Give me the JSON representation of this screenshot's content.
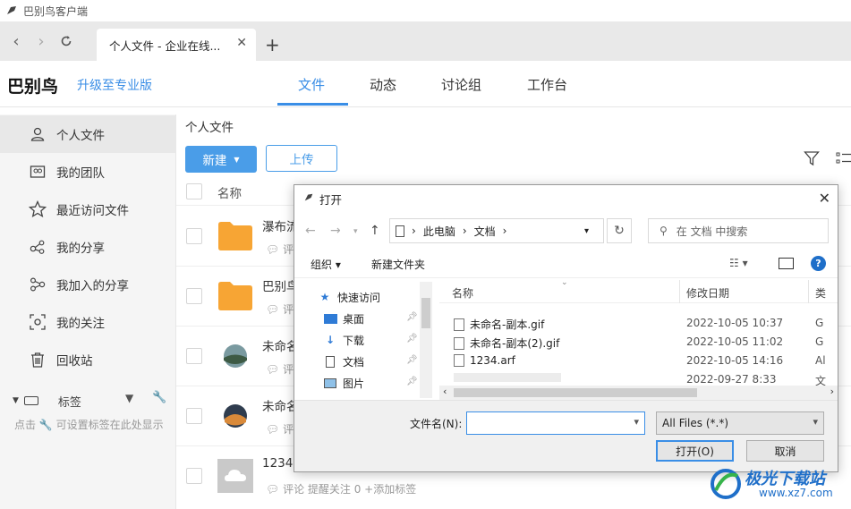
{
  "window": {
    "title": "巴别鸟客户端"
  },
  "browser": {
    "tab_title": "个人文件 - 企业在线...",
    "new_tab": "+"
  },
  "header": {
    "brand": "巴别鸟",
    "upgrade": "升级至专业版",
    "tabs": [
      "文件",
      "动态",
      "讨论组",
      "工作台"
    ],
    "active_tab": "文件"
  },
  "sidebar": {
    "items": [
      {
        "label": "个人文件",
        "icon": "user-icon"
      },
      {
        "label": "我的团队",
        "icon": "team-icon"
      },
      {
        "label": "最近访问文件",
        "icon": "star-icon"
      },
      {
        "label": "我的分享",
        "icon": "share-icon"
      },
      {
        "label": "我加入的分享",
        "icon": "joined-share-icon"
      },
      {
        "label": "我的关注",
        "icon": "focus-icon"
      },
      {
        "label": "回收站",
        "icon": "trash-icon"
      }
    ],
    "tags_label": "标签",
    "tags_hint": "点击 🔧 可设置标签在此处显示"
  },
  "main": {
    "breadcrumb": "个人文件",
    "new_button": "新建",
    "upload_button": "上传",
    "column_name": "名称",
    "files": [
      {
        "name": "瀑布流",
        "meta": "评",
        "kind": "folder"
      },
      {
        "name": "巴别鸟",
        "meta": "评",
        "kind": "folder"
      },
      {
        "name": "未命名",
        "meta": "评",
        "kind": "image1"
      },
      {
        "name": "未命名",
        "meta": "评",
        "kind": "image2"
      },
      {
        "name": "1234.",
        "meta": "评论   提醒关注 0   +添加标签",
        "kind": "cloud"
      }
    ]
  },
  "dialog": {
    "title": "打开",
    "address": [
      "此电脑",
      "文档"
    ],
    "search_placeholder": "在 文档 中搜索",
    "organize": "组织 ▾",
    "new_folder": "新建文件夹",
    "nav": [
      "快速访问",
      "桌面",
      "下载",
      "文档",
      "图片"
    ],
    "columns": {
      "name": "名称",
      "modified": "修改日期",
      "type": "类"
    },
    "files": [
      {
        "name": "未命名-副本.gif",
        "date": "2022-10-05 10:37",
        "type": "G"
      },
      {
        "name": "未命名-副本(2).gif",
        "date": "2022-10-05 11:02",
        "type": "G"
      },
      {
        "name": "1234.arf",
        "date": "2022-10-05 14:16",
        "type": "Al"
      },
      {
        "name": "",
        "date": "2022-09-27 8:33",
        "type": "文"
      }
    ],
    "filename_label": "文件名(N):",
    "filename_value": "",
    "filter": "All Files (*.*)",
    "open_button": "打开(O)",
    "cancel_button": "取消"
  },
  "watermark": {
    "text": "极光下载站",
    "url": "www.xz7.com"
  },
  "colors": {
    "accent": "#3a8ee6",
    "folder": "#f7a534"
  }
}
